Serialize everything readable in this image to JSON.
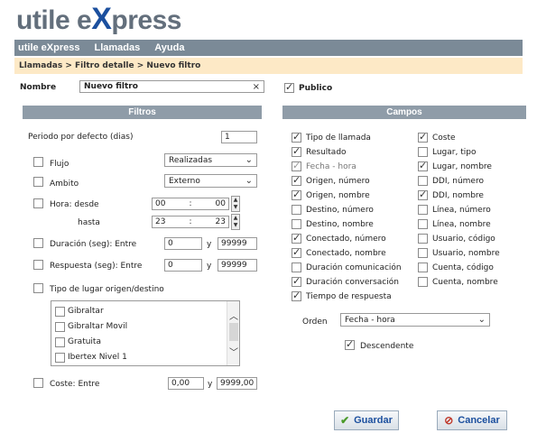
{
  "app": {
    "logo_prefix": "utile e",
    "logo_x": "X",
    "logo_suffix": "press"
  },
  "menu": {
    "items": [
      "utile eXpress",
      "Llamadas",
      "Ayuda"
    ]
  },
  "breadcrumb": "Llamadas > Filtro detalle > Nuevo filtro",
  "nombre": {
    "label": "Nombre",
    "value": "Nuevo filtro",
    "clear": "×"
  },
  "publico": {
    "label": "Publico",
    "checked": true
  },
  "filtros": {
    "header": "Filtros",
    "periodo_label": "Periodo por defecto (dias)",
    "periodo_value": "1",
    "flujo_label": "Flujo",
    "flujo_value": "Realizadas",
    "ambito_label": "Ambito",
    "ambito_value": "Externo",
    "hora_desde_label": "Hora: desde",
    "hora_desde_h": "00",
    "hora_desde_m": "00",
    "hora_hasta_label": "hasta",
    "hora_hasta_h": "23",
    "hora_hasta_m": "23",
    "duracion_label": "Duración (seg): Entre",
    "duracion_min": "0",
    "duracion_max": "99999",
    "respuesta_label": "Respuesta (seg): Entre",
    "respuesta_min": "0",
    "respuesta_max": "99999",
    "y": "y",
    "colon": ":",
    "tipo_lugar_label": "Tipo de lugar origen/destino",
    "tipo_lugar_items": [
      "Gibraltar",
      "Gibraltar Movil",
      "Gratuita",
      "Ibertex Nivel 1"
    ],
    "coste_label": "Coste: Entre",
    "coste_min": "0,00",
    "coste_max": "9999,00"
  },
  "campos": {
    "header": "Campos",
    "left": [
      {
        "label": "Tipo de llamada",
        "checked": true
      },
      {
        "label": "Resultado",
        "checked": true
      },
      {
        "label": "Fecha - hora",
        "checked": true,
        "disabled": true
      },
      {
        "label": "Origen, número",
        "checked": true
      },
      {
        "label": "Origen, nombre",
        "checked": true
      },
      {
        "label": "Destino, número",
        "checked": false
      },
      {
        "label": "Destino, nombre",
        "checked": false
      },
      {
        "label": "Conectado, número",
        "checked": true
      },
      {
        "label": "Conectado, nombre",
        "checked": true
      },
      {
        "label": "Duración comunicación",
        "checked": false
      },
      {
        "label": "Duración conversación",
        "checked": true
      },
      {
        "label": "Tiempo de respuesta",
        "checked": true
      }
    ],
    "right": [
      {
        "label": "Coste",
        "checked": true
      },
      {
        "label": "Lugar, tipo",
        "checked": false
      },
      {
        "label": "Lugar, nombre",
        "checked": true
      },
      {
        "label": "DDI, número",
        "checked": false
      },
      {
        "label": "DDI, nombre",
        "checked": true
      },
      {
        "label": "Línea, número",
        "checked": false
      },
      {
        "label": "Línea, nombre",
        "checked": false
      },
      {
        "label": "Usuario, código",
        "checked": false
      },
      {
        "label": "Usuario, nombre",
        "checked": false
      },
      {
        "label": "Cuenta, código",
        "checked": false
      },
      {
        "label": "Cuenta, nombre",
        "checked": false
      }
    ],
    "orden_label": "Orden",
    "orden_value": "Fecha - hora",
    "descendente_label": "Descendente",
    "descendente_checked": true
  },
  "buttons": {
    "guardar": "Guardar",
    "cancelar": "Cancelar"
  },
  "colors": {
    "menubar": "#7b8a97",
    "breadcrumb_bg": "#fde9c6",
    "section_header": "#8f9ca8",
    "logo_gray": "#636f7c",
    "logo_blue": "#1b4f9e",
    "guardar_icon": "#4a9a2a",
    "cancelar_icon": "#c0392b"
  }
}
